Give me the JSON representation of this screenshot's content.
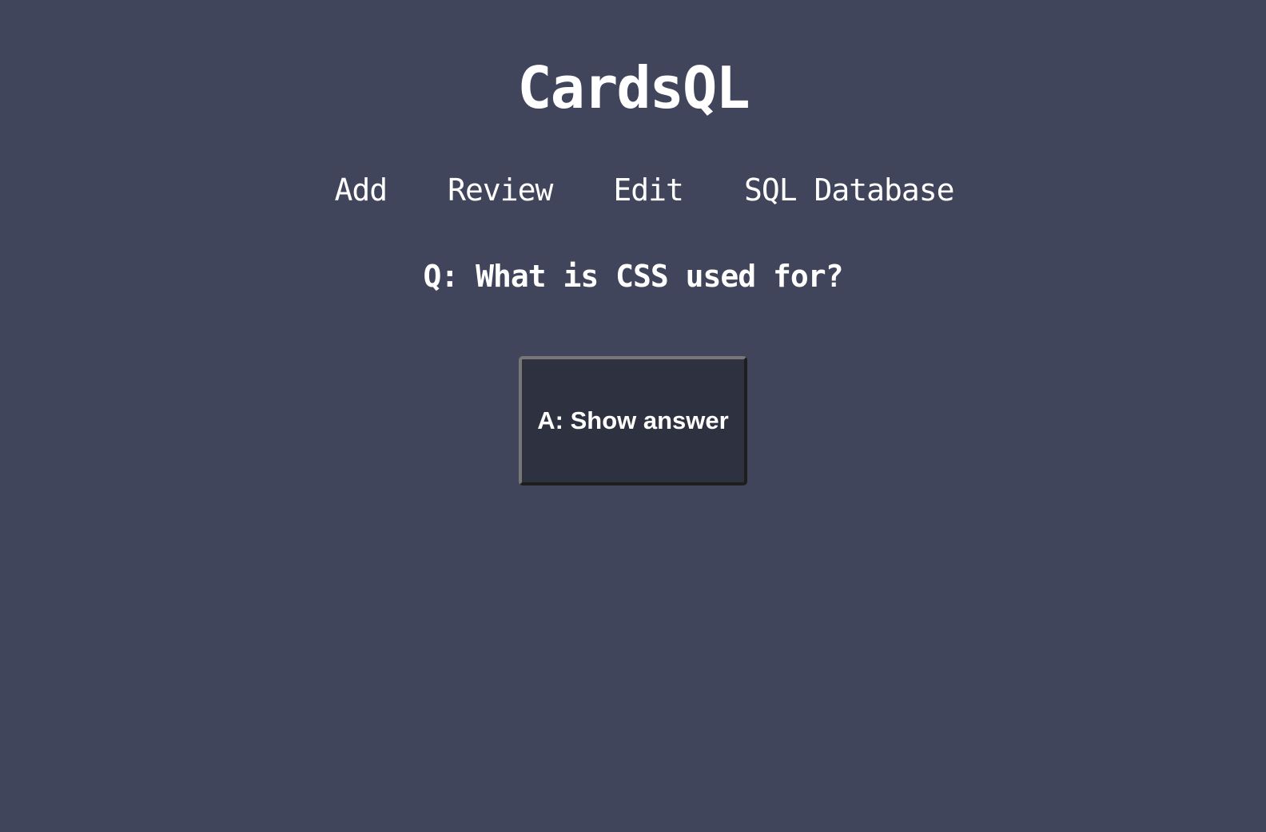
{
  "app": {
    "title": "CardsQL"
  },
  "nav": {
    "items": [
      {
        "label": "Add"
      },
      {
        "label": "Review"
      },
      {
        "label": "Edit"
      },
      {
        "label": "SQL Database"
      }
    ]
  },
  "card": {
    "question": "Q: What is CSS used for?",
    "answer_button_label": "A: Show answer"
  },
  "colors": {
    "background": "#41455b",
    "button_background": "#2e3240",
    "text": "#ffffff"
  }
}
